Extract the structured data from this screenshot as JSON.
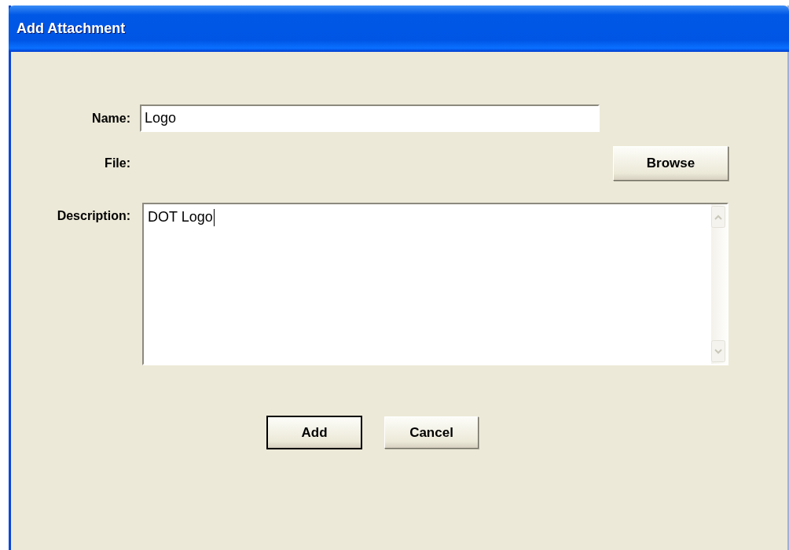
{
  "window": {
    "title": "Add Attachment"
  },
  "name_field": {
    "label": "Name:",
    "value": "Logo"
  },
  "file_field": {
    "label": "File:",
    "button": "Browse"
  },
  "description_field": {
    "label": "Description:",
    "value": "DOT Logo",
    "focused": true
  },
  "buttons": [
    {
      "label": "Add",
      "default": true
    },
    {
      "label": "Cancel",
      "default": false
    }
  ]
}
